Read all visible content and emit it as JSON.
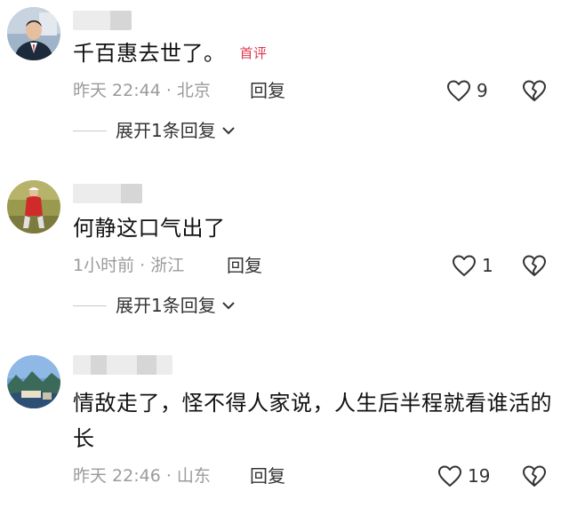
{
  "comments": [
    {
      "text": "千百惠去世了。",
      "badge": "首评",
      "meta": "昨天 22:44 · 北京",
      "reply_label": "回复",
      "like_count": "9",
      "expand_label": "展开1条回复"
    },
    {
      "text": "何静这口气出了",
      "badge": "",
      "meta": "1小时前 · 浙江",
      "reply_label": "回复",
      "like_count": "1",
      "expand_label": "展开1条回复"
    },
    {
      "text": "情敌走了，怪不得人家说，人生后半程就看谁活的长",
      "badge": "",
      "meta": "昨天 22:46 · 山东",
      "reply_label": "回复",
      "like_count": "19",
      "expand_label": ""
    }
  ],
  "icons": {
    "like": "heart-outline-icon",
    "dislike": "broken-heart-icon",
    "expand": "chevron-down-icon"
  }
}
